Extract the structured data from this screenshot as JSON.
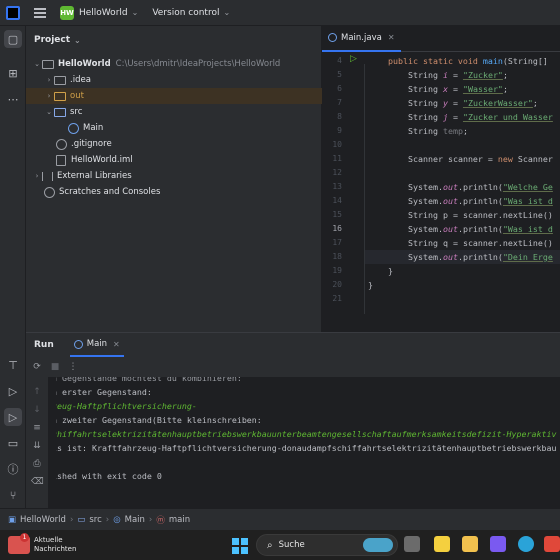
{
  "titlebar": {
    "project_badge": "HW",
    "project_name": "HelloWorld",
    "vcs": "Version control"
  },
  "project_panel": {
    "title": "Project",
    "root": {
      "name": "HelloWorld",
      "path": "C:\\Users\\dmitr\\IdeaProjects\\HelloWorld"
    },
    "items": [
      {
        "label": ".idea"
      },
      {
        "label": "out"
      },
      {
        "label": "src"
      },
      {
        "label": "Main"
      },
      {
        "label": ".gitignore"
      },
      {
        "label": "HelloWorld.iml"
      },
      {
        "label": "External Libraries"
      },
      {
        "label": "Scratches and Consoles"
      }
    ]
  },
  "editor": {
    "tab": "Main.java",
    "line_numbers": [
      "4",
      "5",
      "6",
      "7",
      "8",
      "9",
      "10",
      "11",
      "12",
      "13",
      "14",
      "15",
      "16",
      "17",
      "18",
      "19",
      "20",
      "21"
    ],
    "current_line": "16"
  },
  "run_panel": {
    "title": "Run",
    "tab": "Main",
    "output": [
      "n Gegenstände möchtest du kombinieren:",
      "n erster Gegenstand:",
      "zeug-Haftpflichtversicherung-",
      "n zweiter Gegenstand(Bitte kleinschreiben:",
      "chiffahrtselektrizitätenhauptbetriebswerkbauunterbeamtengesellschaftaufmerksamkeitsdefizit-Hyperaktiv",
      "ls ist: Kraftfahrzeug-Haftpflichtversicherung-donaudampfschiffahrtselektrizitätenhauptbetriebswerkbau",
      "",
      "ished with exit code 0"
    ]
  },
  "statusbar": {
    "crumbs": [
      "HelloWorld",
      "src",
      "Main",
      "main"
    ]
  },
  "taskbar": {
    "news_badge": "1",
    "news_line1": "Aktuelle",
    "news_line2": "Nachrichten",
    "search": "Suche"
  }
}
